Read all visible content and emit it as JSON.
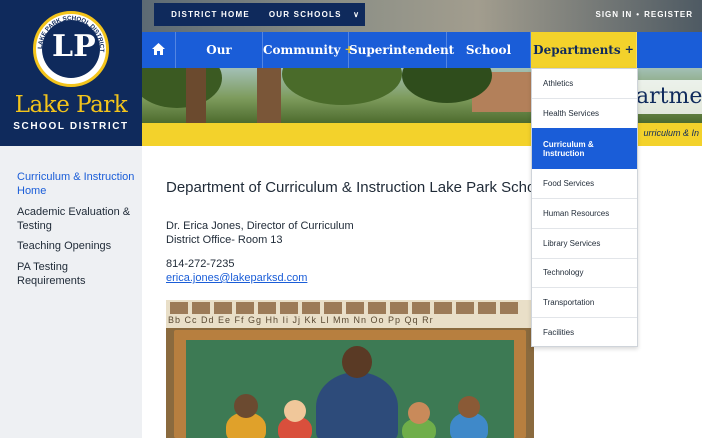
{
  "brand": {
    "name": "Lake Park",
    "subtitle": "SCHOOL DISTRICT",
    "seal_monogram": "LP",
    "seal_ring_text": "LAKE PARK SCHOOL DISTRICT"
  },
  "topbar": {
    "district_home": "DISTRICT HOME",
    "our_schools": "OUR SCHOOLS",
    "sign_in": "SIGN IN",
    "register": "REGISTER"
  },
  "nav": {
    "items": [
      {
        "label": "Our District",
        "plus": "+"
      },
      {
        "label": "Community",
        "plus": "+"
      },
      {
        "label": "Superintendent"
      },
      {
        "label": "School Board"
      },
      {
        "label": "Departments",
        "plus": "+"
      }
    ]
  },
  "hero": {
    "title_partial": "artmen",
    "breadcrumb_partial": "urriculum & In"
  },
  "sidebar": {
    "items": [
      {
        "label": "Curriculum & Instruction Home",
        "active": true
      },
      {
        "label": "Academic Evaluation & Testing"
      },
      {
        "label": "Teaching Openings"
      },
      {
        "label": "PA Testing Requirements"
      }
    ]
  },
  "main": {
    "title": "Department of Curriculum & Instruction Lake Park School District",
    "director": "Dr. Erica Jones, Director of Curriculum",
    "office": "District Office- Room 13",
    "phone": "814-272-7235",
    "email": "erica.jones@lakeparksd.com",
    "photo_alphabet": "Bb  Cc  Dd  Ee  Ff  Gg  Hh  Ii  Jj  Kk  Ll  Mm  Nn  Oo  Pp  Qq  Rr"
  },
  "dropdown": {
    "items": [
      {
        "label": "Athletics"
      },
      {
        "label": "Health Services"
      },
      {
        "label": "Curriculum & Instruction",
        "active": true
      },
      {
        "label": "Food Services"
      },
      {
        "label": "Human Resources"
      },
      {
        "label": "Library Services"
      },
      {
        "label": "Technology"
      },
      {
        "label": "Transportation"
      },
      {
        "label": "Facilities"
      }
    ]
  },
  "colors": {
    "navy": "#0f2a5c",
    "nav_blue": "#1a5dd8",
    "gold": "#f3d22b"
  }
}
